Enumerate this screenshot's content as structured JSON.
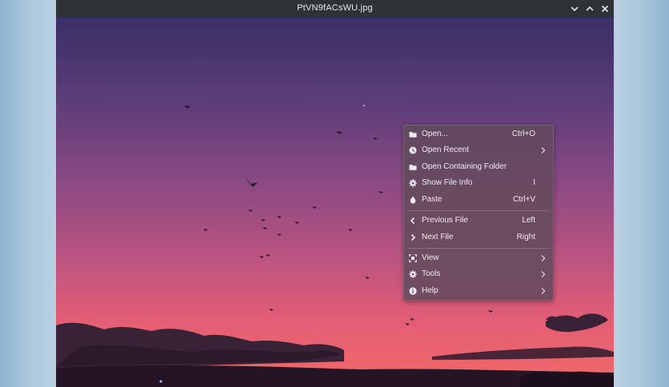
{
  "window": {
    "title": "PtVN9fACsWU.jpg"
  },
  "menu": {
    "items": [
      {
        "label": "Open...",
        "shortcut": "Ctrl+O",
        "icon": "folder-icon"
      },
      {
        "label": "Open Recent",
        "shortcut": "",
        "icon": "clock-icon",
        "submenu": true
      },
      {
        "label": "Open Containing Folder",
        "shortcut": "",
        "icon": "folder-icon"
      },
      {
        "label": "Show File Info",
        "shortcut": "I",
        "icon": "gear-icon"
      },
      {
        "label": "Paste",
        "shortcut": "Ctrl+V",
        "icon": "drop-icon"
      },
      {
        "label": "Previous File",
        "shortcut": "Left",
        "icon": "chevron-left-icon"
      },
      {
        "label": "Next File",
        "shortcut": "Right",
        "icon": "chevron-right-icon"
      },
      {
        "label": "View",
        "shortcut": "",
        "icon": "focus-icon",
        "submenu": true
      },
      {
        "label": "Tools",
        "shortcut": "",
        "icon": "gear-icon",
        "submenu": true
      },
      {
        "label": "Help",
        "shortcut": "",
        "icon": "info-icon",
        "submenu": true
      }
    ]
  },
  "colors": {
    "titlebar": "#2e3136",
    "sky_top": "#3a2f66",
    "sky_mid": "#a14d80",
    "sky_bottom": "#f0606a",
    "menu_bg": "#624a5c"
  }
}
